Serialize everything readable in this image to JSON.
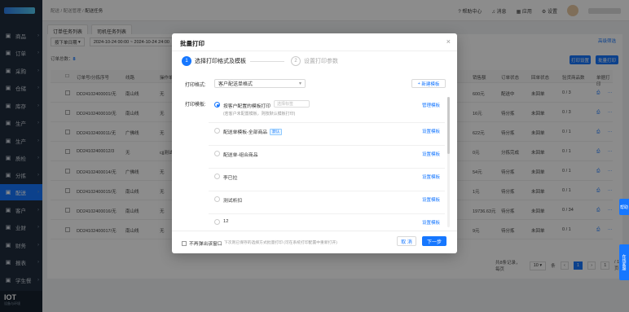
{
  "sidebar": {
    "items": [
      {
        "label": "商品",
        "icon": "grid-icon"
      },
      {
        "label": "订单",
        "icon": "order-icon"
      },
      {
        "label": "采购",
        "icon": "purchase-icon"
      },
      {
        "label": "仓储",
        "icon": "warehouse-icon"
      },
      {
        "label": "库存",
        "icon": "stock-icon"
      },
      {
        "label": "生产",
        "icon": "production-icon"
      },
      {
        "label": "生产",
        "icon": "production-icon"
      },
      {
        "label": "质检",
        "icon": "inspect-icon"
      },
      {
        "label": "分拣",
        "icon": "sort-icon"
      },
      {
        "label": "配送",
        "icon": "delivery-icon",
        "active": true
      },
      {
        "label": "客户",
        "icon": "customer-icon"
      },
      {
        "label": "业财",
        "icon": "finance-icon"
      },
      {
        "label": "财务",
        "icon": "money-icon"
      },
      {
        "label": "报表",
        "icon": "report-icon"
      },
      {
        "label": "学生餐",
        "icon": "meal-icon"
      }
    ],
    "brand": {
      "title": "IOT",
      "subtitle": "设备与环境"
    }
  },
  "topbar": {
    "breadcrumb": [
      "配送",
      "配送管理",
      "配送任务"
    ],
    "help": "帮助中心",
    "messages": "消息",
    "apps": "应用",
    "settings": "设置"
  },
  "tabs": [
    "订单任务列表",
    "司机任务列表"
  ],
  "filters": {
    "date_type": "按下单日期",
    "date_range": "2024-10-24 00:00 ~ 2024-10-24 24:00",
    "advanced": "高级筛选"
  },
  "summary": {
    "label": "订单总数：",
    "value": "8"
  },
  "actions": {
    "print": "打印设置",
    "batch_print": "批量打印"
  },
  "table": {
    "headers": [
      "订单号/分拣序号",
      "线路",
      "操作单",
      "销售额",
      "订单状态",
      "回单状态",
      "验货商品数",
      "单据打印"
    ],
    "rows": [
      {
        "id": "DD24102400001/无",
        "route": "南山线",
        "op": "无",
        "amount": "600元",
        "status": "配送中",
        "receipt": "未回单",
        "count": "0 / 3"
      },
      {
        "id": "DD24102400010/无",
        "route": "南山线",
        "op": "无",
        "amount": "16元",
        "status": "待分拣",
        "receipt": "未回单",
        "count": "0 / 3"
      },
      {
        "id": "DD24102400011/无",
        "route": "广佛线",
        "op": "无",
        "amount": "622元",
        "status": "待分拣",
        "receipt": "未回单",
        "count": "0 / 1"
      },
      {
        "id": "DD24102400012/3",
        "route": "无",
        "op": "cjj测试",
        "amount": "0元",
        "status": "分拣完成",
        "receipt": "未回单",
        "count": "0 / 1"
      },
      {
        "id": "DD24102400014/无",
        "route": "广佛线",
        "op": "无",
        "amount": "54元",
        "status": "待分拣",
        "receipt": "未回单",
        "count": "0 / 1"
      },
      {
        "id": "DD24102400015/无",
        "route": "南山线",
        "op": "无",
        "amount": "1元",
        "status": "待分拣",
        "receipt": "未回单",
        "count": "0 / 1"
      },
      {
        "id": "DD24102400016/无",
        "route": "南山线",
        "op": "无",
        "amount": "19736.63元",
        "status": "待分拣",
        "receipt": "未回单",
        "count": "0 / 34"
      },
      {
        "id": "DD24102400017/无",
        "route": "南山线",
        "op": "无",
        "amount": "9元",
        "status": "待分拣",
        "receipt": "未回单",
        "count": "0 / 1"
      }
    ]
  },
  "pagination": {
    "total": "共8条记录，每页",
    "page_size": "10",
    "unit": "条",
    "current": "1",
    "pages": "1",
    "goto_suffix": "/ 1页"
  },
  "floating": {
    "help": "帮助",
    "service": "在线客服"
  },
  "modal": {
    "title": "批量打印",
    "steps": [
      {
        "num": "1",
        "label": "选择打印格式及模板"
      },
      {
        "num": "2",
        "label": "设置打印参数"
      }
    ],
    "format_label": "打印格式:",
    "format_value": "客户配送单格式",
    "new_template": "新建模板",
    "template_label": "打印模板:",
    "templates": [
      {
        "label": "按客户配置的模板打印",
        "placeholder": "选择标签",
        "sub": "(若客户未配置模板，则按默认模板打印)",
        "link": "管理模板",
        "selected": true,
        "badge": ""
      },
      {
        "label": "配送单模板-全部商品",
        "badge": "默认",
        "link": "设置模板"
      },
      {
        "label": "配送单-组合商品",
        "badge": "",
        "link": "设置模板"
      },
      {
        "label": "李已拉",
        "badge": "",
        "link": "设置模板"
      },
      {
        "label": "测试析扣",
        "badge": "",
        "link": "设置模板"
      },
      {
        "label": "12",
        "badge": "",
        "link": "设置模板"
      }
    ],
    "dont_show": "不再弹出该窗口",
    "hint": "下次则已保存的选择方式批量打印 (可在系统打印配置中重新打开)",
    "cancel": "取 消",
    "next": "下一步"
  },
  "colors": {
    "primary": "#1677ff",
    "sidebar": "#1f2d3d"
  }
}
